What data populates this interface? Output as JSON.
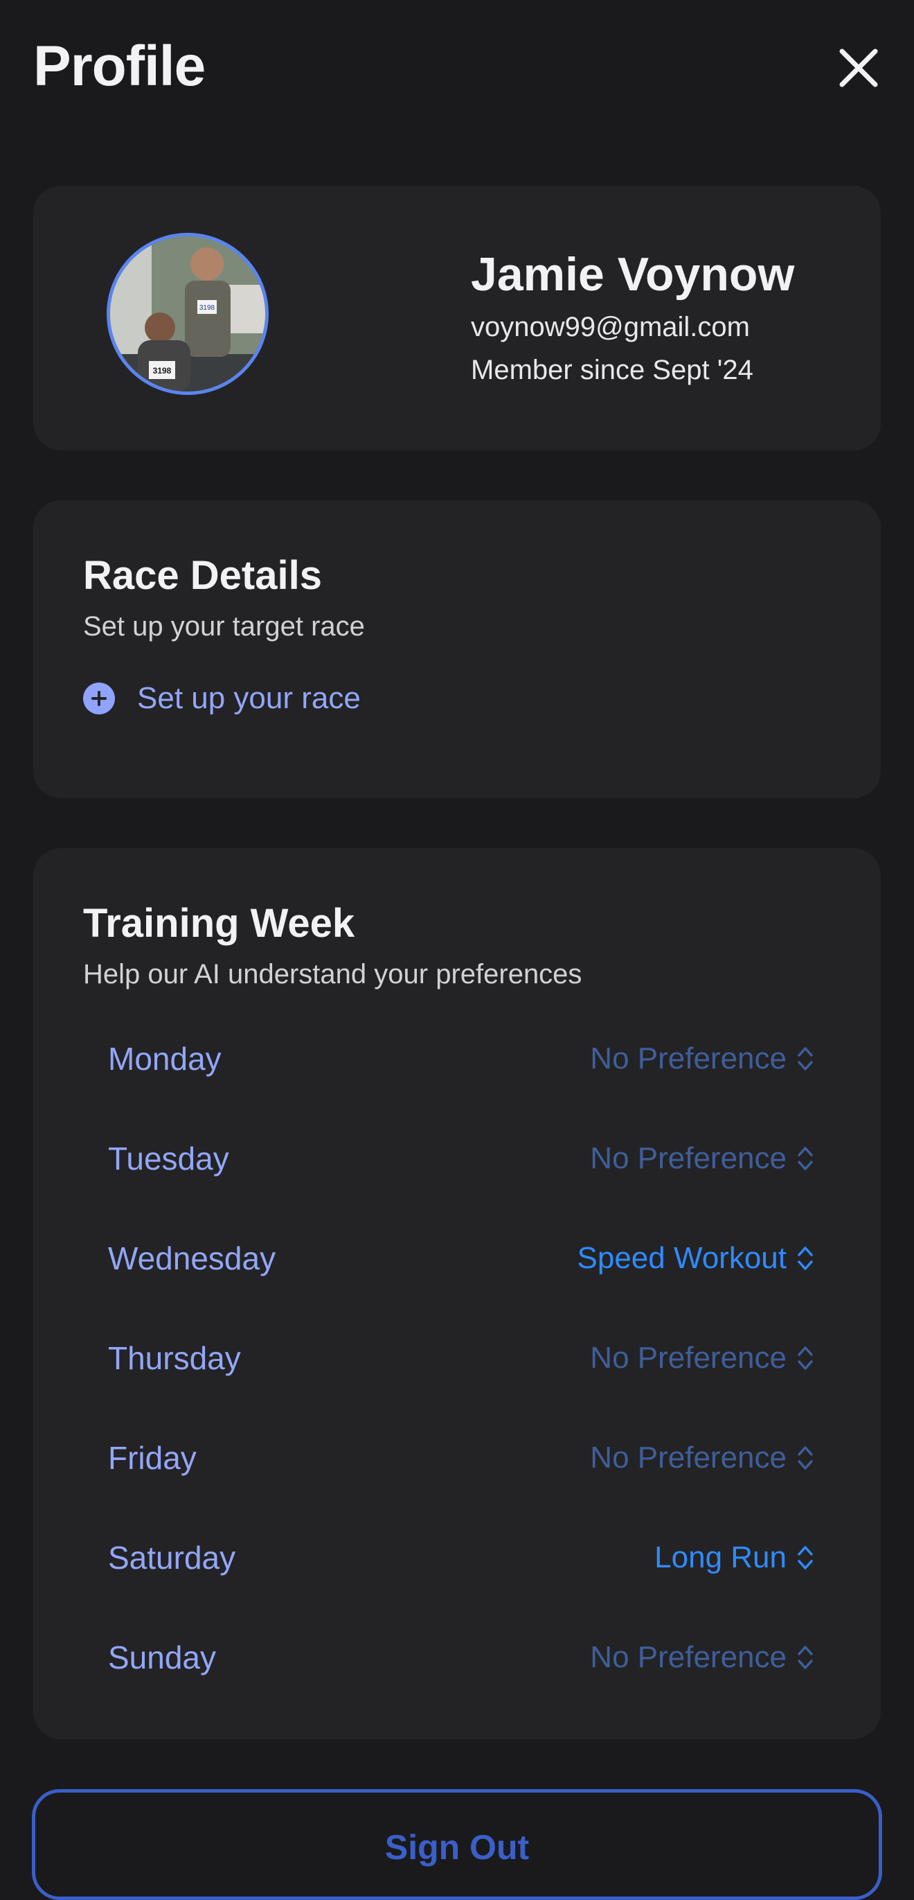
{
  "header": {
    "title": "Profile"
  },
  "profile": {
    "name": "Jamie Voynow",
    "email": "voynow99@gmail.com",
    "member_since": "Member since Sept '24",
    "avatar_bibs": [
      "3198",
      "3198"
    ]
  },
  "race": {
    "title": "Race Details",
    "subtitle": "Set up your target race",
    "action_label": "Set up your race"
  },
  "training": {
    "title": "Training Week",
    "subtitle": "Help our AI understand your preferences",
    "days": [
      {
        "day": "Monday",
        "value": "No Preference",
        "selected": false
      },
      {
        "day": "Tuesday",
        "value": "No Preference",
        "selected": false
      },
      {
        "day": "Wednesday",
        "value": "Speed Workout",
        "selected": true
      },
      {
        "day": "Thursday",
        "value": "No Preference",
        "selected": false
      },
      {
        "day": "Friday",
        "value": "No Preference",
        "selected": false
      },
      {
        "day": "Saturday",
        "value": "Long Run",
        "selected": true
      },
      {
        "day": "Sunday",
        "value": "No Preference",
        "selected": false
      }
    ]
  },
  "footer": {
    "signout_label": "Sign Out"
  },
  "colors": {
    "background": "#1a1a1c",
    "card": "#232325",
    "accent": "#2f8bff",
    "label_blue": "#93a6f8",
    "muted_blue": "#3f5e9a",
    "signout": "#3b5fc9"
  }
}
